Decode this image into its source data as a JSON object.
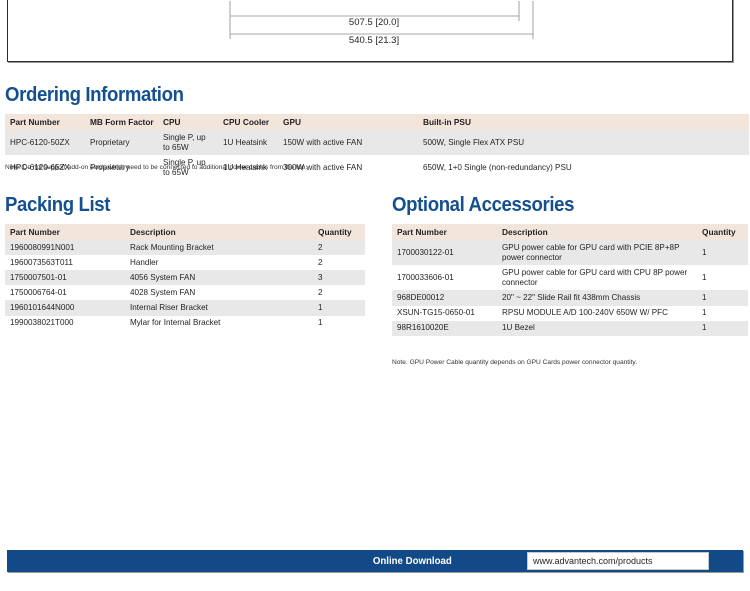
{
  "drawing": {
    "dimension_labels": [
      "507.5 [20.0]",
      "540.5 [21.3]"
    ]
  },
  "ordering": {
    "heading": "Ordering Information",
    "columns": [
      "Part Number",
      "MB Form Factor",
      "CPU",
      "CPU Cooler",
      "GPU",
      "Built-in PSU"
    ],
    "rows": [
      [
        "HPC-6120-50ZX",
        "Proprietary",
        "Single P, up to 65W",
        "1U Heatsink",
        "150W with active FAN",
        "500W, Single Flex ATX PSU"
      ],
      [
        "HPC-6120-65ZX",
        "Proprietary",
        "Single P, up to 65W",
        "1U Heatsink",
        "300W with active FAN",
        "650W, 1+0 Single (non-redundancy) PSU"
      ]
    ],
    "note": "Note: Do not support add-on cards which need to be connected to additional power cables from the top."
  },
  "packing": {
    "heading": "Packing List",
    "columns": [
      "Part Number",
      "Description",
      "Quantity"
    ],
    "rows": [
      [
        "1960080991N001",
        "Rack Mounting Bracket",
        "2"
      ],
      [
        "1960073563T011",
        "Handler",
        "2"
      ],
      [
        "1750007501-01",
        "4056 System FAN",
        "3"
      ],
      [
        "1750006764-01",
        "4028 System FAN",
        "2"
      ],
      [
        "1960101644N000",
        "Internal Riser Bracket",
        "1"
      ],
      [
        "1990038021T000",
        "Mylar for Internal Bracket",
        "1"
      ]
    ]
  },
  "accessories": {
    "heading": "Optional Accessories",
    "columns": [
      "Part Number",
      "Description",
      "Quantity"
    ],
    "rows": [
      [
        "1700030122-01",
        "GPU power cable for GPU card with PCIE 8P+8P power connector",
        "1"
      ],
      [
        "1700033606-01",
        "GPU power cable for GPU card with CPU 8P power connector",
        "1"
      ],
      [
        "968DE00012",
        "20\" ~ 22\" Slide Rail fit 438mm Chassis",
        "1"
      ],
      [
        "XSUN-TG15-0650-01",
        "RPSU MODULE A/D 100-240V 650W W/ PFC",
        "1"
      ],
      [
        "98R1610020E",
        "1U Bezel",
        "1"
      ]
    ],
    "note": "Note. GPU Power Cable quantity depends on GPU Cards power connector quantity."
  },
  "footer": {
    "label": "Online Download",
    "url": "www.advantech.com/products"
  },
  "colors": {
    "heading_blue": "#14508f",
    "footer_blue": "#114a86",
    "table_header_beige": "#f2e6dc",
    "row_stripe_gray": "#e8e8e8"
  }
}
